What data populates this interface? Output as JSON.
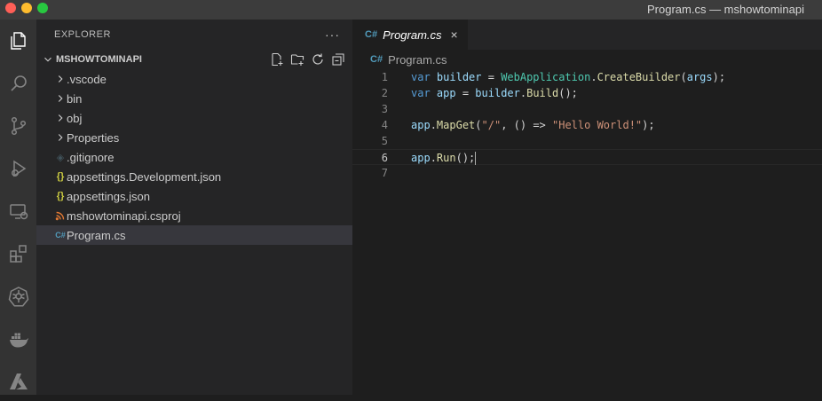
{
  "window": {
    "title": "Program.cs — mshowtominapi"
  },
  "colors": {
    "activity_bar": "#333333",
    "sidebar": "#252526",
    "editor": "#1e1e1e",
    "selected_item": "#37373d",
    "keyword": "#569cd6",
    "type": "#4ec9b0",
    "string": "#ce9178",
    "function": "#dcdcaa"
  },
  "activity_bar": {
    "items": [
      {
        "icon": "files-icon"
      },
      {
        "icon": "search-icon"
      },
      {
        "icon": "source-control-icon"
      },
      {
        "icon": "run-debug-icon"
      },
      {
        "icon": "remote-explorer-icon"
      },
      {
        "icon": "extensions-icon"
      },
      {
        "icon": "kubernetes-icon"
      },
      {
        "icon": "docker-icon"
      },
      {
        "icon": "azure-icon"
      }
    ]
  },
  "explorer": {
    "title": "EXPLORER",
    "more": "···",
    "folder": "MSHOWTOMINAPI",
    "items": [
      {
        "label": ".vscode",
        "kind": "folder"
      },
      {
        "label": "bin",
        "kind": "folder"
      },
      {
        "label": "obj",
        "kind": "folder"
      },
      {
        "label": "Properties",
        "kind": "folder"
      },
      {
        "label": ".gitignore",
        "kind": "git",
        "icon": "◈"
      },
      {
        "label": "appsettings.Development.json",
        "kind": "json",
        "icon": "{}"
      },
      {
        "label": "appsettings.json",
        "kind": "json",
        "icon": "{}"
      },
      {
        "label": "mshowtominapi.csproj",
        "kind": "rss",
        "icon": "⁾"
      },
      {
        "label": "Program.cs",
        "kind": "cs",
        "icon": "C#"
      }
    ]
  },
  "editor": {
    "tab_label": "Program.cs",
    "tab_icon": "C#",
    "close": "×",
    "breadcrumb": "Program.cs",
    "line_numbers": [
      "1",
      "2",
      "3",
      "4",
      "5",
      "6",
      "7"
    ],
    "code": {
      "l1": {
        "kw": "var",
        "v": "builder",
        "eq": " = ",
        "ty": "WebApplication",
        "dot": ".",
        "fn": "CreateBuilder",
        "open": "(",
        "arg": "args",
        "close": ");"
      },
      "l2": {
        "kw": "var",
        "v": "app",
        "eq": " = ",
        "obj": "builder",
        "dot": ".",
        "fn": "Build",
        "close": "();"
      },
      "l4": {
        "obj": "app",
        "dot": ".",
        "fn": "MapGet",
        "open": "(",
        "s1": "\"/\"",
        "mid": ", () => ",
        "s2": "\"Hello World!\"",
        "close": ");"
      },
      "l6": {
        "obj": "app",
        "dot": ".",
        "fn": "Run",
        "close": "();"
      }
    }
  }
}
